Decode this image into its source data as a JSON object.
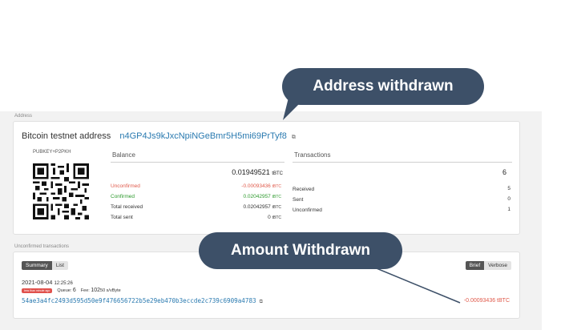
{
  "address_section": {
    "label": "Address",
    "title": "Bitcoin testnet address",
    "address": "n4GP4Js9kJxcNpiNGeBmr5H5mi69PrTyf8",
    "address_type": "PUBKEY+P2PKH",
    "balance": {
      "heading": "Balance",
      "total": "0.01949521",
      "total_unit": "tBTC",
      "rows": [
        {
          "label": "Unconfirmed",
          "value": "-0.00093436",
          "unit": "tBTC",
          "color": "#e05a4b"
        },
        {
          "label": "Confirmed",
          "value": "0.02042957",
          "unit": "tBTC",
          "color": "#2e9a2e"
        },
        {
          "label": "Total received",
          "value": "0.02042957",
          "unit": "tBTC",
          "color": "#333333"
        },
        {
          "label": "Total sent",
          "value": "0",
          "unit": "tBTC",
          "color": "#333333"
        }
      ]
    },
    "transactions": {
      "heading": "Transactions",
      "total": "6",
      "rows": [
        {
          "label": "Received",
          "value": "5"
        },
        {
          "label": "Sent",
          "value": "0"
        },
        {
          "label": "Unconfirmed",
          "value": "1"
        }
      ]
    }
  },
  "unconfirmed_section": {
    "label": "Unconfirmed transactions",
    "view_tabs": [
      "Summary",
      "List"
    ],
    "detail_tabs": [
      "Brief",
      "Verbose"
    ],
    "tx": {
      "date": "2021-08-04",
      "time": "12:25:26",
      "badge": "less than minute ago",
      "queue_label": "Queue:",
      "queue": "6",
      "fee_label": "Fee:",
      "fee": "102",
      "fee_unit": "50 s/vByte",
      "hash": "54ae3a4fc2493d595d50e9f476656722b5e29eb470b3eccde2c739c6909a4783",
      "amount": "-0.00093436 tBTC"
    }
  },
  "callouts": {
    "address_withdrawn": "Address withdrawn",
    "amount_withdrawn": "Amount Withdrawn",
    "color": "#3d5068"
  }
}
